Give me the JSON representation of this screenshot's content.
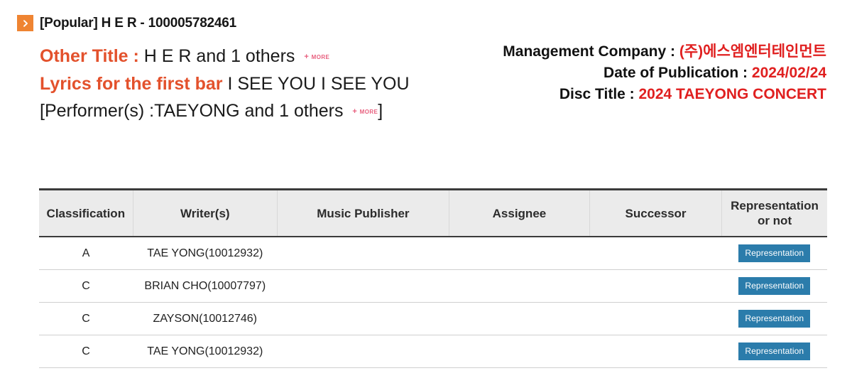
{
  "header": {
    "arrow_icon": "chevron-right-icon",
    "accent_orange": "#ef8432",
    "title": "[Popular] H E R - 100005782461"
  },
  "info_left": {
    "other_title_label": "Other Title :",
    "other_title_value": "H E R and 1 others",
    "other_title_more": "+ more",
    "lyrics_label": "Lyrics for the first bar",
    "lyrics_value": "I SEE YOU I SEE YOU",
    "performer_prefix": "[Performer(s) :",
    "performer_value": "TAEYONG and 1 others",
    "performer_more": "+ more",
    "performer_suffix": "]",
    "label_color": "#e3512c",
    "more_color": "#e8607f"
  },
  "info_right": {
    "management_label": "Management Company :",
    "management_value": "(주)에스엠엔터테인먼트",
    "publication_label": "Date of Publication :",
    "publication_value": "2024/02/24",
    "disc_label": "Disc Title :",
    "disc_value": "2024 TAEYONG CONCERT",
    "value_color": "#e02020"
  },
  "table": {
    "columns": [
      "Classification",
      "Writer(s)",
      "Music Publisher",
      "Assignee",
      "Successor",
      "Representation\nor not"
    ],
    "column_labels": {
      "classification": "Classification",
      "writers": "Writer(s)",
      "music_publisher": "Music Publisher",
      "assignee": "Assignee",
      "successor": "Successor",
      "representation_line1": "Representation",
      "representation_line2": "or not"
    },
    "badge_label": "Representation",
    "badge_color": "#2b7cab",
    "rows": [
      {
        "classification": "A",
        "writer": "TAE YONG(10012932)",
        "music_publisher": "",
        "assignee": "",
        "successor": "",
        "representation": "Representation"
      },
      {
        "classification": "C",
        "writer": "BRIAN CHO(10007797)",
        "music_publisher": "",
        "assignee": "",
        "successor": "",
        "representation": "Representation"
      },
      {
        "classification": "C",
        "writer": "ZAYSON(10012746)",
        "music_publisher": "",
        "assignee": "",
        "successor": "",
        "representation": "Representation"
      },
      {
        "classification": "C",
        "writer": "TAE YONG(10012932)",
        "music_publisher": "",
        "assignee": "",
        "successor": "",
        "representation": "Representation"
      }
    ]
  }
}
